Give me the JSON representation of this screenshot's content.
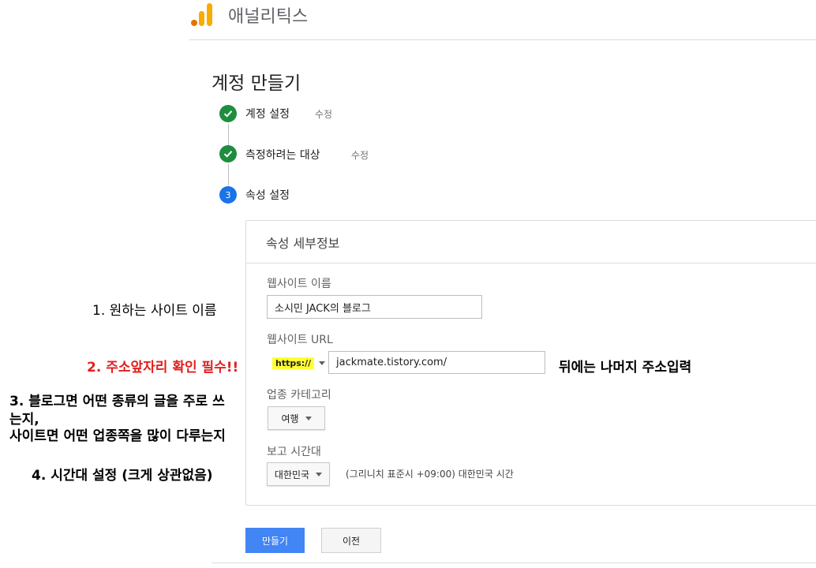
{
  "header": {
    "app_title": "애널리틱스"
  },
  "page_title": "계정 만들기",
  "steps": [
    {
      "label": "계정 설정",
      "edit": "수정",
      "status": "done"
    },
    {
      "label": "측정하려는 대상",
      "edit": "수정",
      "status": "done"
    },
    {
      "label": "속성 설정",
      "number": "3",
      "status": "current"
    }
  ],
  "card": {
    "title": "속성 세부정보",
    "site_name_label": "웹사이트 이름",
    "site_name_value": "소시민 JACK의 블로그",
    "url_label": "웹사이트 URL",
    "protocol": "https://",
    "url_value": "jackmate.tistory.com/",
    "category_label": "업종 카테고리",
    "category_value": "여행",
    "timezone_label": "보고 시간대",
    "timezone_country": "대한민국",
    "timezone_text": "(그리니치 표준시 +09:00) 대한민국 시간"
  },
  "buttons": {
    "create": "만들기",
    "previous": "이전"
  },
  "annotations": {
    "a1": "1. 원하는 사이트 이름",
    "a2": "2. 주소앞자리 확인 필수!!",
    "a2_right": "뒤에는 나머지 주소입력",
    "a3_line1": "3. 블로그면 어떤 종류의 글을 주로 쓰",
    "a3_line2": "는지,",
    "a3_line3": "사이트면 어떤 업종쪽을 많이 다루는지",
    "a4": "4. 시간대 설정 (크게 상관없음)"
  },
  "colors": {
    "step_done": "#1e8e3e",
    "step_current": "#1a73e8",
    "primary_button": "#4285f4",
    "highlight": "#ffff33",
    "annotation_red": "#e0201e"
  }
}
